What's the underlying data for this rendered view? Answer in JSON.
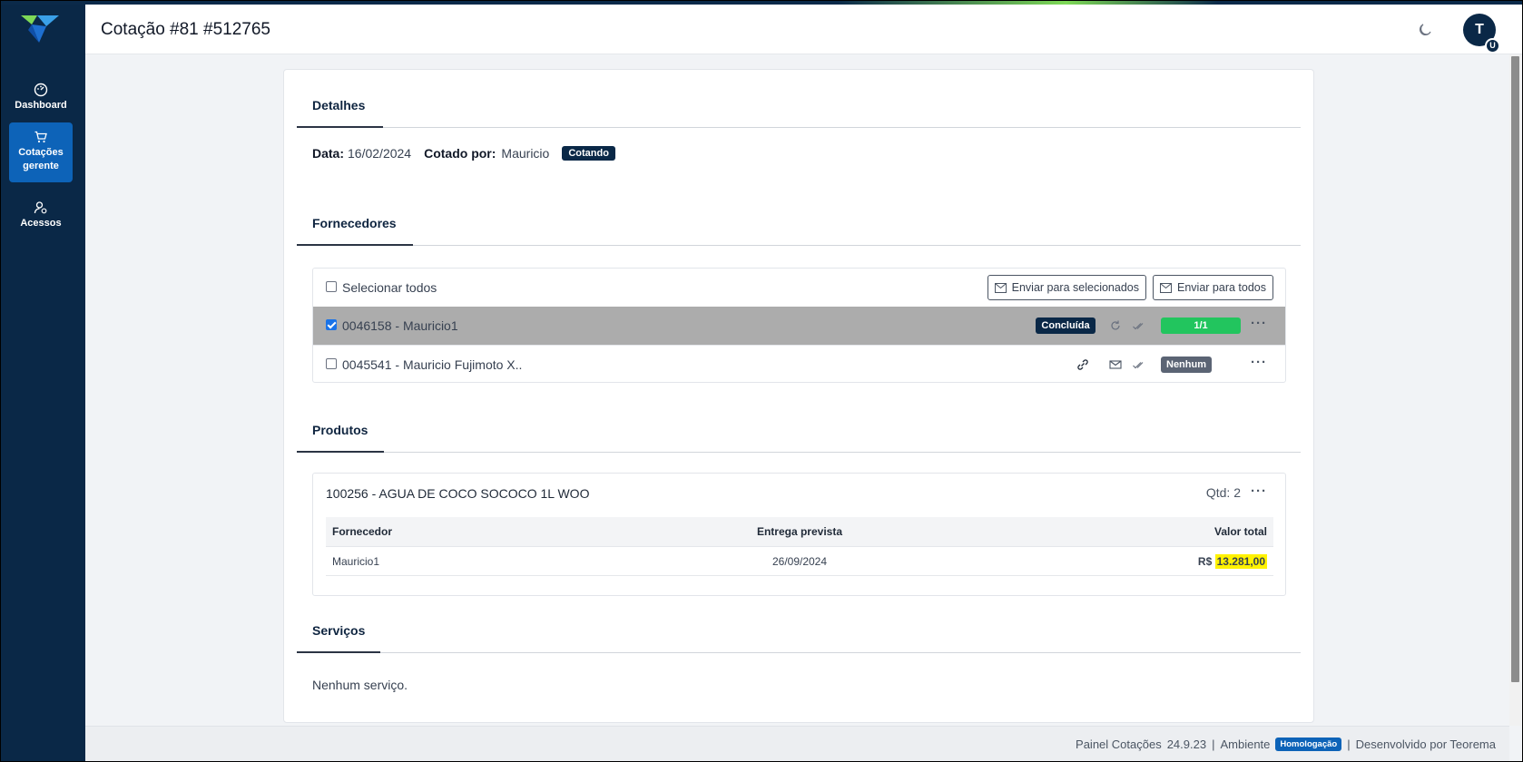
{
  "header": {
    "title": "Cotação #81 #512765",
    "avatar_initial": "T",
    "avatar_badge": "U"
  },
  "sidebar": {
    "items": [
      {
        "label": "Dashboard",
        "icon": "dashboard-gauge-icon"
      },
      {
        "label_line1": "Cotações",
        "label_line2": "gerente",
        "icon": "cart-icon"
      },
      {
        "label": "Acessos",
        "icon": "user-gear-icon"
      }
    ]
  },
  "detalhes": {
    "title": "Detalhes",
    "data_label": "Data:",
    "data_value": "16/02/2024",
    "cotado_label": "Cotado por:",
    "cotado_value": "Mauricio",
    "status": "Cotando"
  },
  "fornecedores": {
    "title": "Fornecedores",
    "select_all": "Selecionar todos",
    "send_selected": "Enviar para selecionados",
    "send_all": "Enviar para todos",
    "rows": [
      {
        "label": "0046158 - Mauricio1",
        "checked": true,
        "status": "Concluída",
        "progress": "1/1"
      },
      {
        "label": "0045541 - Mauricio Fujimoto X..",
        "checked": false,
        "status": "Nenhum"
      }
    ]
  },
  "produtos": {
    "title": "Produtos",
    "item_title": "100256 - AGUA DE COCO SOCOCO 1L WOO",
    "qtd": "Qtd: 2",
    "columns": [
      "Fornecedor",
      "Entrega prevista",
      "Valor total"
    ],
    "rows": [
      {
        "fornecedor": "Mauricio1",
        "entrega": "26/09/2024",
        "currency": "R$",
        "valor": "13.281,00"
      }
    ]
  },
  "servicos": {
    "title": "Serviços",
    "empty": "Nenhum serviço."
  },
  "footer": {
    "app": "Painel Cotações",
    "version": "24.9.23",
    "sep": "|",
    "env_label": "Ambiente",
    "env_badge": "Homologação",
    "dev": "Desenvolvido por Teorema"
  },
  "colors": {
    "sidebar": "#0a2847",
    "active": "#0d63b8",
    "success": "#22c55e",
    "highlight": "#fff200"
  }
}
